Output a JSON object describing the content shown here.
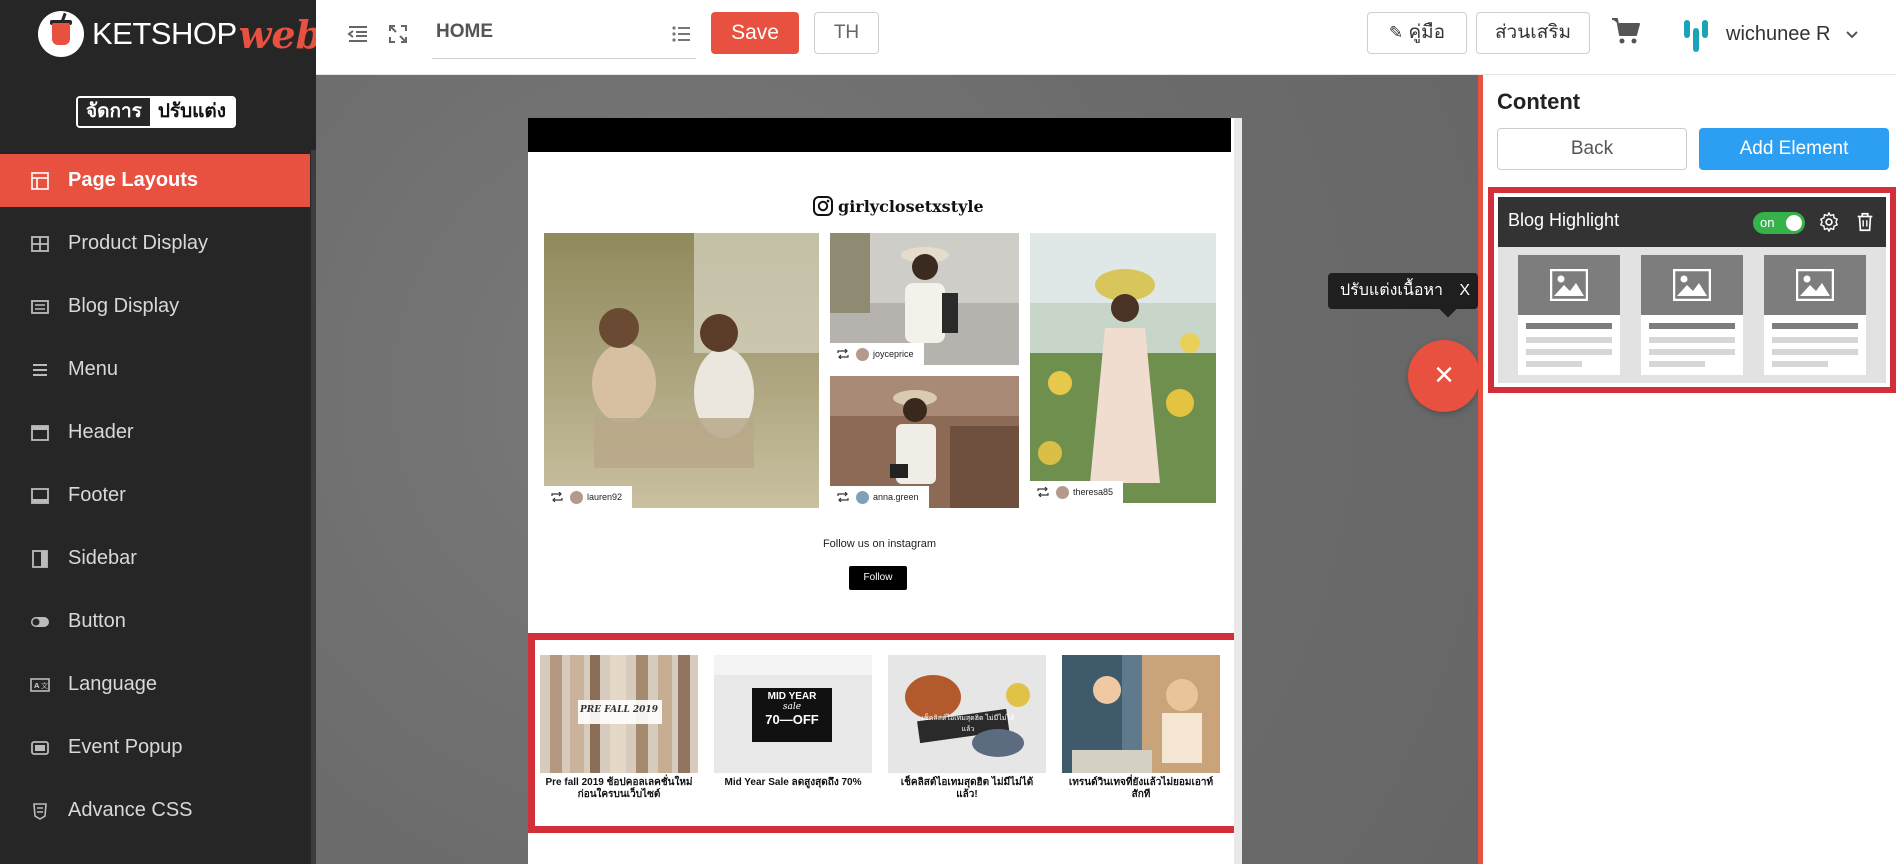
{
  "app": {
    "logo_main": "KETSHOP",
    "logo_accent": "web",
    "mode_manage": "จัดการ",
    "mode_customize": "ปรับแต่ง"
  },
  "sidebar": {
    "items": [
      {
        "label": "Page Layouts",
        "icon": "layout-icon",
        "active": true
      },
      {
        "label": "Product Display",
        "icon": "grid-icon",
        "active": false
      },
      {
        "label": "Blog Display",
        "icon": "list-card-icon",
        "active": false
      },
      {
        "label": "Menu",
        "icon": "hamburger-icon",
        "active": false
      },
      {
        "label": "Header",
        "icon": "header-icon",
        "active": false
      },
      {
        "label": "Footer",
        "icon": "footer-icon",
        "active": false
      },
      {
        "label": "Sidebar",
        "icon": "sidebar-icon",
        "active": false
      },
      {
        "label": "Button",
        "icon": "toggle-icon",
        "active": false
      },
      {
        "label": "Language",
        "icon": "language-icon",
        "active": false
      },
      {
        "label": "Event Popup",
        "icon": "popup-icon",
        "active": false
      },
      {
        "label": "Advance CSS",
        "icon": "css-icon",
        "active": false
      }
    ]
  },
  "topbar": {
    "page_name": "HOME",
    "save_label": "Save",
    "lang_label": "TH",
    "guide_label": "คู่มือ",
    "addon_label": "ส่วนเสริม",
    "user_name": "wichunee R"
  },
  "preview": {
    "ig_handle": "girlyclosetxstyle",
    "photos": [
      {
        "user": "lauren92"
      },
      {
        "user": "joyceprice"
      },
      {
        "user": "anna.green"
      },
      {
        "user": "theresa85"
      }
    ],
    "follow_text": "Follow us on instagram",
    "follow_button": "Follow",
    "blog_posts": [
      {
        "title": "Pre fall 2019 ช้อปคอลเลคชั่นใหม่ก่อนใครบนเว็บไซต์",
        "image_text": "PRE FALL 2019"
      },
      {
        "title": "Mid Year Sale ลดสูงสุดถึง 70%",
        "image_text_1": "MID YEAR",
        "image_text_2": "sale",
        "image_text_3": "70—OFF"
      },
      {
        "title": "เช็คลิสต์ไอเทมสุดฮิต ไม่มีไม่ได้แล้ว!",
        "image_text": "เช็คลิสต์ไอเทมสุดฮิต ไม่มีไม่ได้แล้ว"
      },
      {
        "title": "เทรนด์วินเทจที่ยังแล้วไม่ยอมเอาท์สักที",
        "image_text": ""
      }
    ]
  },
  "hint": {
    "text": "ปรับแต่งเนื้อหา",
    "close": "X"
  },
  "fab": {
    "label": "×"
  },
  "right_panel": {
    "title": "Content",
    "back_label": "Back",
    "add_label": "Add Element",
    "element": {
      "title": "Blog Highlight",
      "toggle_label": "on",
      "toggle_on": true
    }
  },
  "colors": {
    "accent": "#e8503f",
    "highlight": "#d32f3a",
    "primary_blue": "#2d9ff3",
    "toggle_green": "#35b34a",
    "sidebar_bg": "#262626"
  }
}
